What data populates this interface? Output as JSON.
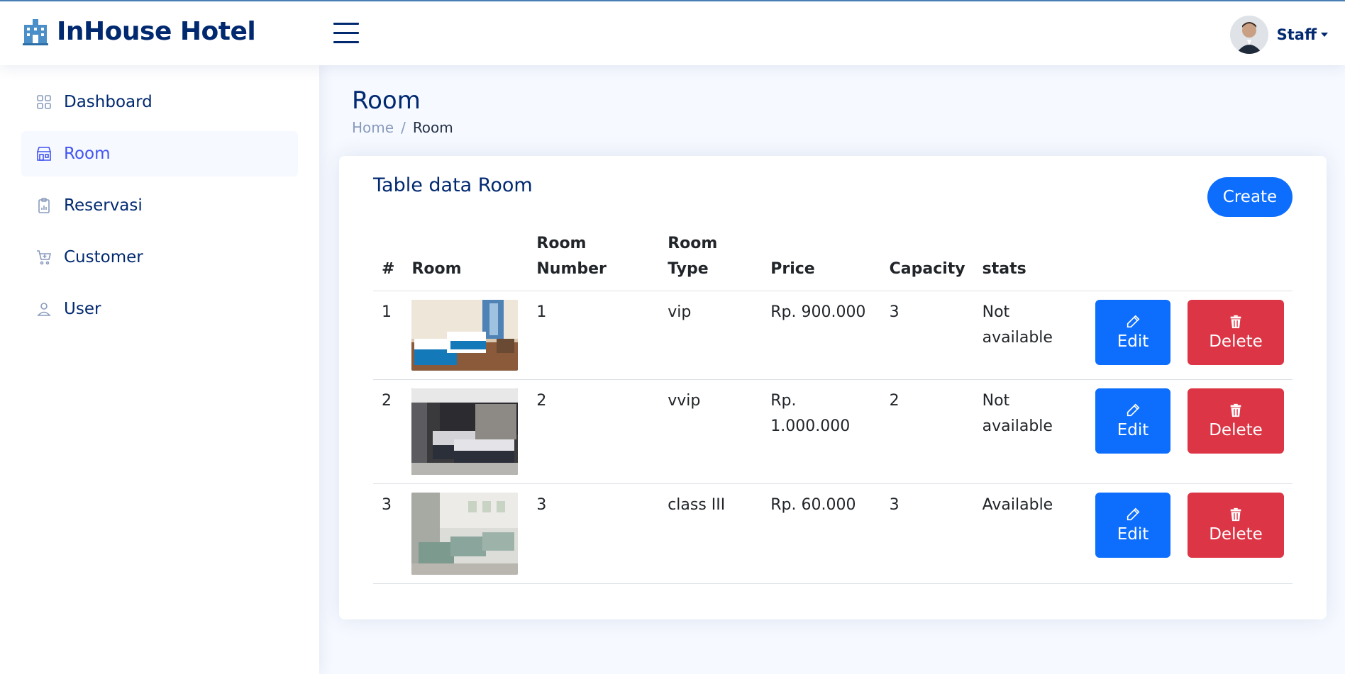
{
  "app": {
    "name": "InHouse Hotel",
    "user": "Staff"
  },
  "sidebar": {
    "items": [
      {
        "label": "Dashboard",
        "icon": "grid-icon"
      },
      {
        "label": "Room",
        "icon": "shop-icon"
      },
      {
        "label": "Reservasi",
        "icon": "clipboard-data-icon"
      },
      {
        "label": "Customer",
        "icon": "cart-icon"
      },
      {
        "label": "User",
        "icon": "person-icon"
      }
    ],
    "active": "Room"
  },
  "page": {
    "title": "Room",
    "breadcrumb": [
      "Home",
      "Room"
    ]
  },
  "card": {
    "title": "Table data Room",
    "create_label": "Create"
  },
  "table": {
    "headers": [
      "#",
      "Room",
      "Room Number",
      "Room Type",
      "Price",
      "Capacity",
      "stats"
    ],
    "rows": [
      {
        "no": "1",
        "room_number": "1",
        "room_type": "vip",
        "price": "Rp. 900.000",
        "capacity": "3",
        "status": "Not available",
        "image": "hotel-room-photo-blue"
      },
      {
        "no": "2",
        "room_number": "2",
        "room_type": "vvip",
        "price": "Rp. 1.000.000",
        "capacity": "2",
        "status": "Not available",
        "image": "hotel-room-photo-dark"
      },
      {
        "no": "3",
        "room_number": "3",
        "room_type": "class III",
        "price": "Rp. 60.000",
        "capacity": "3",
        "status": "Available",
        "image": "hotel-room-photo-green"
      }
    ],
    "edit_label": "Edit",
    "delete_label": "Delete"
  },
  "colors": {
    "primary": "#0d6efd",
    "danger": "#dc3545",
    "navy": "#012970"
  }
}
